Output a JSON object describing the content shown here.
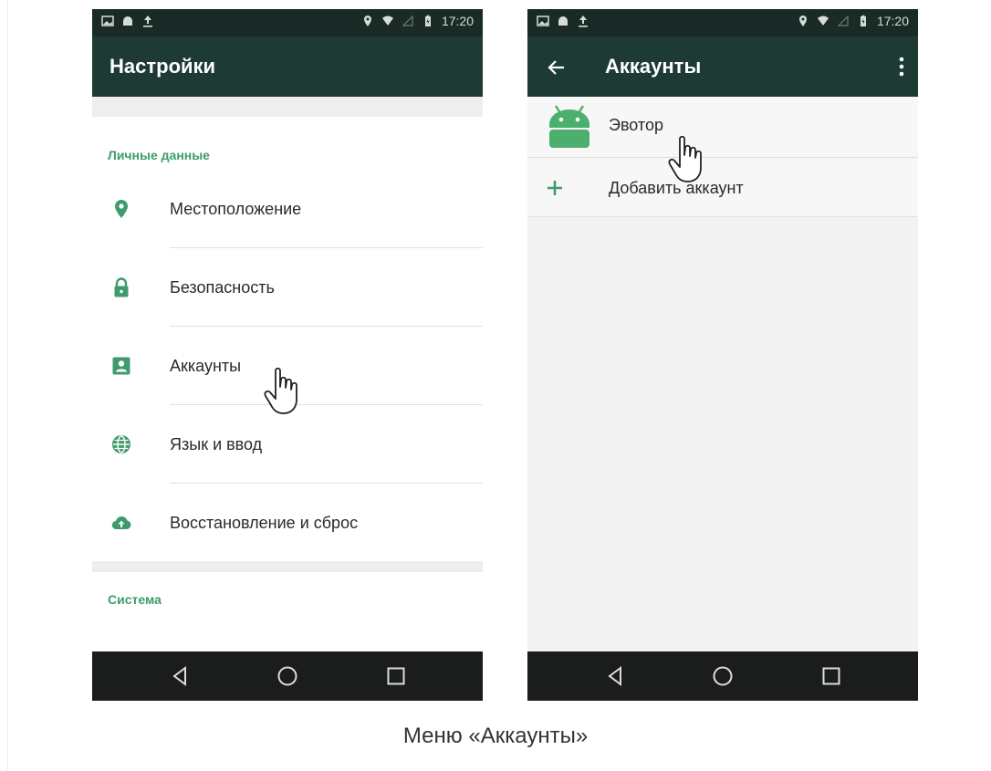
{
  "left_screen": {
    "status_time": "17:20",
    "title": "Настройки",
    "section_personal": "Личные данные",
    "items": [
      {
        "label": "Местоположение",
        "icon": "location-pin-icon"
      },
      {
        "label": "Безопасность",
        "icon": "lock-icon"
      },
      {
        "label": "Аккаунты",
        "icon": "account-box-icon"
      },
      {
        "label": "Язык и ввод",
        "icon": "globe-icon"
      },
      {
        "label": "Восстановление и сброс",
        "icon": "cloud-upload-icon"
      }
    ],
    "section_system": "Система"
  },
  "right_screen": {
    "status_time": "17:20",
    "title": "Аккаунты",
    "account_name": "Эвотор",
    "add_account_label": "Добавить аккаунт"
  },
  "caption": "Меню «Аккаунты»",
  "colors": {
    "accent_green": "#3f9b6e",
    "appbar": "#1d3b34",
    "statusbar": "#1a2a26",
    "navbar": "#1a1d1c"
  }
}
